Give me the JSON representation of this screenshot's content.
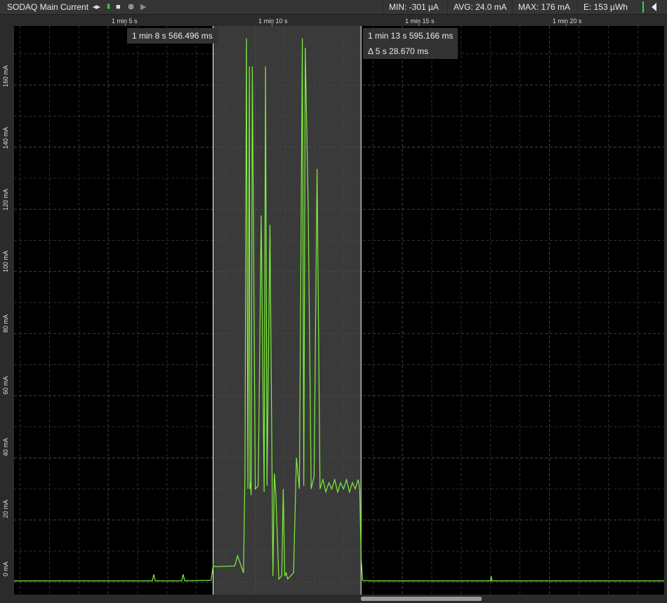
{
  "toolbar": {
    "title": "SODAQ Main Current",
    "stats": {
      "min": "MIN: -301 µA",
      "avg": "AVG: 24.0 mA",
      "max": "MAX: 176 mA",
      "energy": "E: 153 µWh"
    },
    "icons": [
      "horizontal-zoom-icon",
      "vertical-zoom-icon",
      "stop-icon",
      "clear-icon",
      "play-icon"
    ]
  },
  "time_axis": {
    "ticks": [
      "1 min 5 s",
      "1 min 10 s",
      "1 min 15 s",
      "1 min 20 s"
    ]
  },
  "y_axis": {
    "ticks": [
      "0 mA",
      "20 mA",
      "40 mA",
      "60 mA",
      "80 mA",
      "100 mA",
      "120 mA",
      "140 mA",
      "160 mA"
    ]
  },
  "cursors": {
    "left": "1 min 8 s 566.496 ms",
    "right": "1 min 13 s 595.166 ms",
    "delta": "Δ 5 s 28.670 ms"
  },
  "colors": {
    "trace": "#7ff03c",
    "plot_bg": "#000000",
    "selection_bg": "#3a3a3a",
    "grid": "#4a4a4a"
  },
  "chart_data": {
    "type": "line",
    "title": "",
    "xlabel": "",
    "ylabel": "",
    "xlim_s": [
      61.8,
      83.9
    ],
    "ylim_ma": [
      -4,
      179
    ],
    "selection_s": [
      68.566,
      73.595
    ],
    "series": [
      {
        "name": "SODAQ Main Current",
        "x_s": [
          61.8,
          66.5,
          66.55,
          66.6,
          67.5,
          67.55,
          67.6,
          68.5,
          68.57,
          68.6,
          69.3,
          69.4,
          69.6,
          69.65,
          69.7,
          69.75,
          69.8,
          69.82,
          69.84,
          69.86,
          69.9,
          70.0,
          70.1,
          70.2,
          70.3,
          70.35,
          70.4,
          70.5,
          70.6,
          70.65,
          70.7,
          70.8,
          70.9,
          70.95,
          71.0,
          71.05,
          71.1,
          71.2,
          71.3,
          71.4,
          71.5,
          71.6,
          71.65,
          71.7,
          71.8,
          71.9,
          72.0,
          72.1,
          72.2,
          72.3,
          72.4,
          72.5,
          72.6,
          72.7,
          72.8,
          72.9,
          73.0,
          73.1,
          73.2,
          73.3,
          73.4,
          73.5,
          73.55,
          73.6,
          73.65,
          74.0,
          78.0,
          78.02,
          78.04,
          83.9
        ],
        "y_ma": [
          0.4,
          0.4,
          2.5,
          0.4,
          0.4,
          2.5,
          0.4,
          0.6,
          5.5,
          5.0,
          5.2,
          8.5,
          3.0,
          35.0,
          175.0,
          30.0,
          166.0,
          30.0,
          32.0,
          28.0,
          166.0,
          30.0,
          31.0,
          118.0,
          29.0,
          166.0,
          31.0,
          115.0,
          2.0,
          35.0,
          28.0,
          1.0,
          2.0,
          30.0,
          2.0,
          3.0,
          1.0,
          2.0,
          3.0,
          40.0,
          30.0,
          175.0,
          31.0,
          172.0,
          120.0,
          30.0,
          34.0,
          133.0,
          30.0,
          33.0,
          29.0,
          32.0,
          30.0,
          33.0,
          29.0,
          32.0,
          30.0,
          33.0,
          29.0,
          32.0,
          30.0,
          33.0,
          30.0,
          7.5,
          0.5,
          0.4,
          0.4,
          2.0,
          0.4,
          0.4
        ]
      }
    ]
  }
}
